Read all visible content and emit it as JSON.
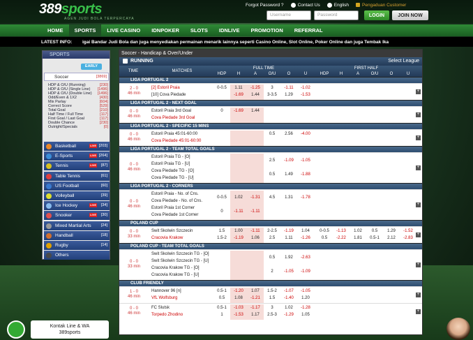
{
  "brand": {
    "logo_a": "389",
    "logo_b": "sports",
    "tagline": "AGEN JUDI BOLA TERPERCAYA"
  },
  "top": {
    "forgot": "Forgot Password ?",
    "contact": "Contact Us",
    "lang": "English",
    "complaint": "Pengaduan Customer",
    "user_ph": "Username",
    "pass_ph": "Password",
    "login": "LOGIN",
    "join": "JOIN NOW"
  },
  "nav": [
    "HOME",
    "SPORTS",
    "LIVE CASINO",
    "IDNPOKER",
    "SLOTS",
    "IDNLIVE",
    "PROMOTION",
    "REFERRAL"
  ],
  "info": {
    "label": "LATEST INFO:",
    "text": "igai Bandar Judi Bola dan juga menyediakan permainan menarik lainnya seperti Casino Online, Slot Online, Poker Online dan juga Tembak Ika"
  },
  "sidebar": {
    "head": "SPORTS",
    "early": "EARLY",
    "soccer": "Soccer",
    "soccer_count": "[3869]",
    "subs": [
      [
        "HDP & O/U (Running)",
        "[230]"
      ],
      [
        "HDP & O/U (Single Line)",
        "[1496]"
      ],
      [
        "HDP & O/U (Double Line)",
        "[1496]"
      ],
      [
        "Odd/Even & 1X2",
        "[430]"
      ],
      [
        "Mix Parlay",
        "[604]"
      ],
      [
        "Correct Score",
        "[529]"
      ],
      [
        "Total Goal",
        "[210]"
      ],
      [
        "Half Time / Full Time",
        "[117]"
      ],
      [
        "First Goal / Last Goal",
        "[117]"
      ],
      [
        "Double Chance",
        "[230]"
      ],
      [
        "Outright/Specials",
        "[0]"
      ]
    ],
    "items": [
      [
        "Basketball",
        "[203]",
        true
      ],
      [
        "E-Sports",
        "[264]",
        true
      ],
      [
        "Tennis",
        "[87]",
        true
      ],
      [
        "Table Tennis",
        "[61]",
        false
      ],
      [
        "US Football",
        "[60]",
        false
      ],
      [
        "Volleyball",
        "[39]",
        false
      ],
      [
        "Ice Hockey",
        "[34]",
        true
      ],
      [
        "Snooker",
        "[30]",
        true
      ],
      [
        "Mixed Martial Arts",
        "[24]",
        false
      ],
      [
        "Handball",
        "[18]",
        false
      ],
      [
        "Rugby",
        "[14]",
        false
      ],
      [
        "Others",
        "",
        false
      ]
    ]
  },
  "main": {
    "title": "Soccer - Handicap & Over/Under",
    "running": "RUNNING",
    "select_league": "Select League",
    "cols": {
      "time": "TIME",
      "matches": "MATCHES",
      "full": "FULL TIME",
      "first": "FIRST HALF",
      "sub": [
        "HDP",
        "H",
        "A",
        "O/U",
        "O",
        "U",
        "HDP",
        "H",
        "A",
        "O/U",
        "O",
        "U"
      ]
    },
    "rows": [
      {
        "league": "LIGA PORTUGAL 2"
      },
      {
        "score": "2 - 0",
        "min": "46 min",
        "teams": [
          "[2] Estoril Praia",
          "[10] Cova Piedade"
        ],
        "fl": [
          "0-0.5",
          "",
          ""
        ],
        "fh": [
          "1.11",
          "-1.69"
        ],
        "fa": [
          "-1.25",
          "1.44"
        ],
        "fou": [
          "3",
          "3-3.5"
        ],
        "fo": [
          "-1.11",
          "1.29"
        ],
        "fu": [
          "-1.02",
          "-1.53"
        ],
        "red": [
          0
        ]
      },
      {
        "league": "LIGA PORTUGAL 2 - NEXT GOAL"
      },
      {
        "score": "0 - 0",
        "min": "46 min",
        "teams": [
          "Estoril Praia 3rd Goal",
          "Cova Piedade 3rd Goal"
        ],
        "fl": [
          "0",
          ""
        ],
        "fh": [
          "-1.69",
          ""
        ],
        "fa": [
          "1.44",
          ""
        ],
        "fou": [
          "",
          ""
        ],
        "fo": [
          "",
          ""
        ],
        "fu": [
          "",
          ""
        ]
      },
      {
        "league": "LIGA PORTUGAL 2 - SPECIFIC 15 MINS"
      },
      {
        "score": "0 - 0",
        "min": "46 min",
        "teams": [
          "Estoril Praia 45:01-60:00",
          "Cova Piedade 45:01-60:00"
        ],
        "fl": [
          "",
          ""
        ],
        "fh": [
          "",
          ""
        ],
        "fa": [
          "",
          ""
        ],
        "fou": [
          "0.5",
          ""
        ],
        "fo": [
          "2.56",
          ""
        ],
        "fu": [
          "-4.00",
          ""
        ]
      },
      {
        "league": "LIGA PORTUGAL 2 - TEAM TOTAL GOALS"
      },
      {
        "score": "0 - 0",
        "min": "46 min",
        "teams": [
          "Estoril Praia TG - [O]",
          "Estoril Praia TG - [U]",
          "Cova Piedade TG - [O]",
          "Cova Piedade TG - [U]"
        ],
        "ou2": [
          [
            "2.5",
            "-1.09",
            "-1.05"
          ],
          [
            "0.5",
            "1.49",
            "-1.88"
          ]
        ]
      },
      {
        "league": "LIGA PORTUGAL 2 - CORNERS"
      },
      {
        "score": "0 - 0",
        "min": "46 min",
        "teams": [
          "Estoril Praia - No. of Cns.",
          "Cova Piedade - No. of Cns.",
          "Estoril Praia 1st Corner",
          "Cova Piedade 1st Corner"
        ],
        "c1": [
          "0-0.5",
          "1.02",
          "-1.31",
          "4.5",
          "1.31",
          "-1.78"
        ],
        "c2": [
          "0",
          "-1.11",
          "-1.11"
        ]
      },
      {
        "league": "POLAND CUP"
      },
      {
        "score": "0 - 0",
        "min": "33 min",
        "teams": [
          "Swit Skolwin Szczecin",
          "Cracovia Krakow"
        ],
        "p1": [
          "1.5",
          "1.00",
          "-1.11",
          "2-2.5",
          "-1.19",
          "1.04",
          "0-0.5",
          "-1.13",
          "1.02",
          "0.5",
          "1.29",
          "-1.52"
        ],
        "p2": [
          "1.5-2",
          "-1.19",
          "1.06",
          "2.5",
          "1.11",
          "-1.26",
          "0.5",
          "-2.22",
          "1.81",
          "0.5-1",
          "2.12",
          "-2.83"
        ]
      },
      {
        "league": "POLAND CUP - TEAM TOTAL GOALS"
      },
      {
        "score": "0 - 0",
        "min": "33 min",
        "teams": [
          "Swit Skolwin Szczecin TG - [O]",
          "Swit Skolwin Szczecin TG - [U]",
          "Cracovia Krakow TG - [O]",
          "Cracovia Krakow TG - [U]"
        ],
        "ou2": [
          [
            "0.5",
            "1.92",
            "-2.63"
          ],
          [
            "2",
            "-1.05",
            "-1.09"
          ]
        ]
      },
      {
        "league": "CLUB FRIENDLY"
      },
      {
        "score": "1 - 0",
        "min": "46 min",
        "teams": [
          "Hannover 96 [n]",
          "VfL Wolfsburg"
        ],
        "f1": [
          "0.5-1",
          "-1.20",
          "1.07",
          "1.5-2",
          "-1.07",
          "-1.05"
        ],
        "f2": [
          "0.5",
          "1.08",
          "-1.21",
          "1.5",
          "-1.40",
          "1.20"
        ]
      },
      {
        "score": "0 - 0",
        "min": "46 min",
        "teams": [
          "FC Slutsk",
          "Torpedo Zhodino"
        ],
        "f1": [
          "0.5-1",
          "-1.03",
          "-1.17",
          "3",
          "1.02",
          "-1.28"
        ],
        "f2": [
          "1",
          "-1.53",
          "1.17",
          "2.5-3",
          "-1.29",
          "1.05"
        ]
      }
    ]
  },
  "chat": {
    "line1": "Kontak Line & WA",
    "line2": "389sports"
  }
}
